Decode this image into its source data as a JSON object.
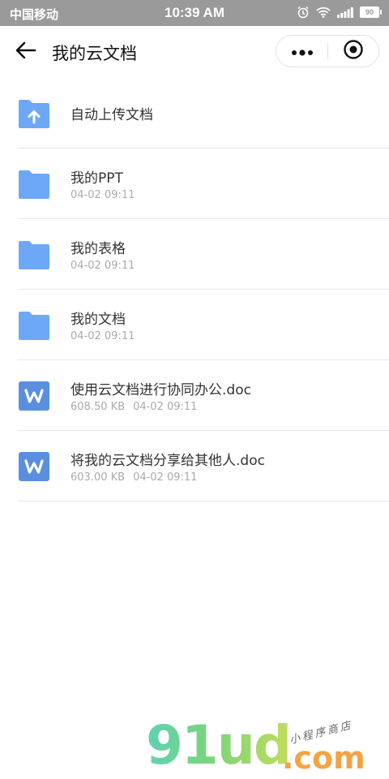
{
  "status_bar": {
    "carrier": "中国移动",
    "time": "10:39 AM",
    "battery": "90"
  },
  "header": {
    "title": "我的云文档"
  },
  "files": [
    {
      "name": "自动上传文档",
      "type": "upload-folder",
      "size": "",
      "date": ""
    },
    {
      "name": "我的PPT",
      "type": "folder",
      "size": "",
      "date": "04-02 09:11"
    },
    {
      "name": "我的表格",
      "type": "folder",
      "size": "",
      "date": "04-02 09:11"
    },
    {
      "name": "我的文档",
      "type": "folder",
      "size": "",
      "date": "04-02 09:11"
    },
    {
      "name": "使用云文档进行协同办公.doc",
      "type": "word-doc",
      "size": "608.50 KB",
      "date": "04-02 09:11"
    },
    {
      "name": "将我的云文档分享给其他人.doc",
      "type": "word-doc",
      "size": "603.00 KB",
      "date": "04-02 09:11"
    }
  ],
  "watermark": {
    "main": "91ud",
    "com": ".com",
    "sub": "小程序商店"
  },
  "colors": {
    "status_bar_bg": "#9a9a9a",
    "folder_blue": "#6da8f7",
    "word_blue": "#5a8fe0",
    "watermark_green": "#7ad47a",
    "watermark_orange": "#f3a343"
  },
  "icons": {
    "back": "arrow-left-icon",
    "more": "more-dots-icon",
    "close": "target-circle-icon",
    "upload_folder": "folder-upload-icon",
    "folder": "folder-icon",
    "word": "word-doc-icon"
  }
}
